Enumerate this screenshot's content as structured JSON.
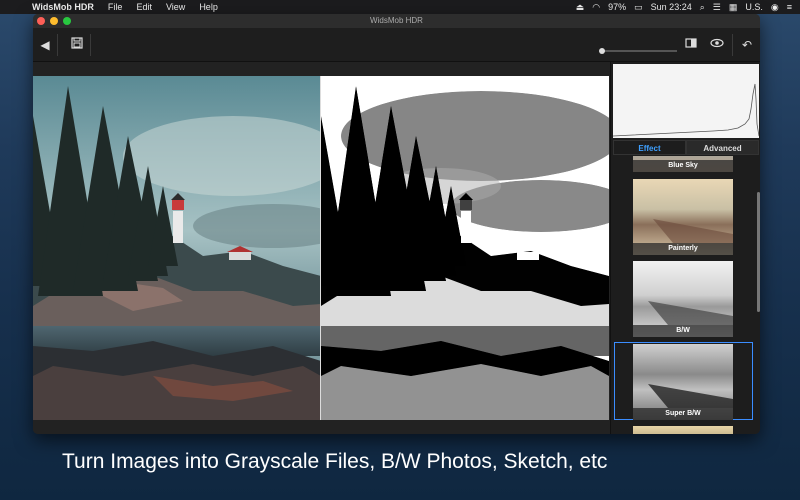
{
  "menubar": {
    "app_name": "WidsMob HDR",
    "items": [
      "File",
      "Edit",
      "View",
      "Help"
    ],
    "battery": "97%",
    "clock": "Sun 23:24",
    "locale": "U.S."
  },
  "window": {
    "title": "WidsMob HDR"
  },
  "panel": {
    "tabs": [
      {
        "label": "Effect",
        "active": true
      },
      {
        "label": "Advanced",
        "active": false
      }
    ],
    "effects": [
      {
        "label": "Blue Sky",
        "selected": false
      },
      {
        "label": "Painterly",
        "selected": false
      },
      {
        "label": "B/W",
        "selected": false
      },
      {
        "label": "Super B/W",
        "selected": true
      }
    ],
    "accent_color": "#3b8dff"
  },
  "caption": "Turn Images into Grayscale Files, B/W Photos, Sketch, etc"
}
